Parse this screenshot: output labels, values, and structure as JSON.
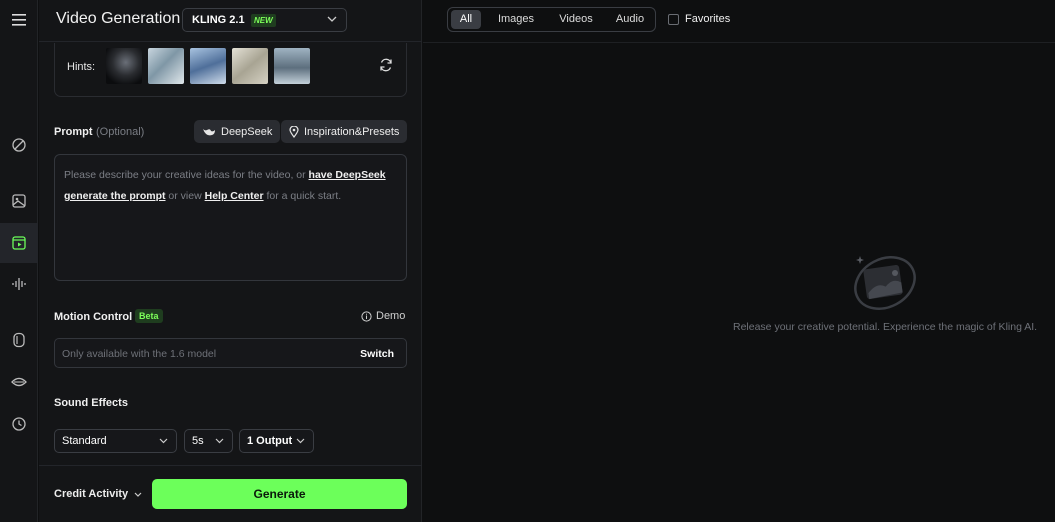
{
  "header": {
    "title": "Video Generation",
    "model": "KLING 2.1",
    "model_badge": "NEW"
  },
  "hints": {
    "label": "Hints:",
    "thumbnails": [
      "eagle-thumb",
      "warrior-thumb",
      "dragon-thumb",
      "statue-thumb",
      "waterfall-thumb"
    ]
  },
  "prompt": {
    "label": "Prompt",
    "optional": "(Optional)",
    "deepseek_button": "DeepSeek",
    "inspiration_button": "Inspiration&Presets",
    "placeholder_1": "Please describe your creative ideas for the video, or ",
    "link_1": "have DeepSeek generate the prompt",
    "placeholder_2": " or view ",
    "link_2": "Help Center",
    "placeholder_3": " for a quick start."
  },
  "motion": {
    "label": "Motion Control",
    "badge": "Beta",
    "demo": "Demo",
    "placeholder": "Only available with the 1.6 model",
    "switch": "Switch"
  },
  "sound": {
    "label": "Sound Effects"
  },
  "options": {
    "mode": "Standard",
    "duration": "5s",
    "outputs": "1 Output"
  },
  "footer": {
    "credit": "Credit Activity",
    "generate": "Generate"
  },
  "tabs": [
    {
      "label": "All"
    },
    {
      "label": "Images"
    },
    {
      "label": "Videos"
    },
    {
      "label": "Audio"
    }
  ],
  "favorites": "Favorites",
  "empty_message": "Release your creative potential. Experience the magic of Kling AI.",
  "colors": {
    "accent": "#6cff5a",
    "background": "#0e0f10",
    "panel": "#141517"
  }
}
